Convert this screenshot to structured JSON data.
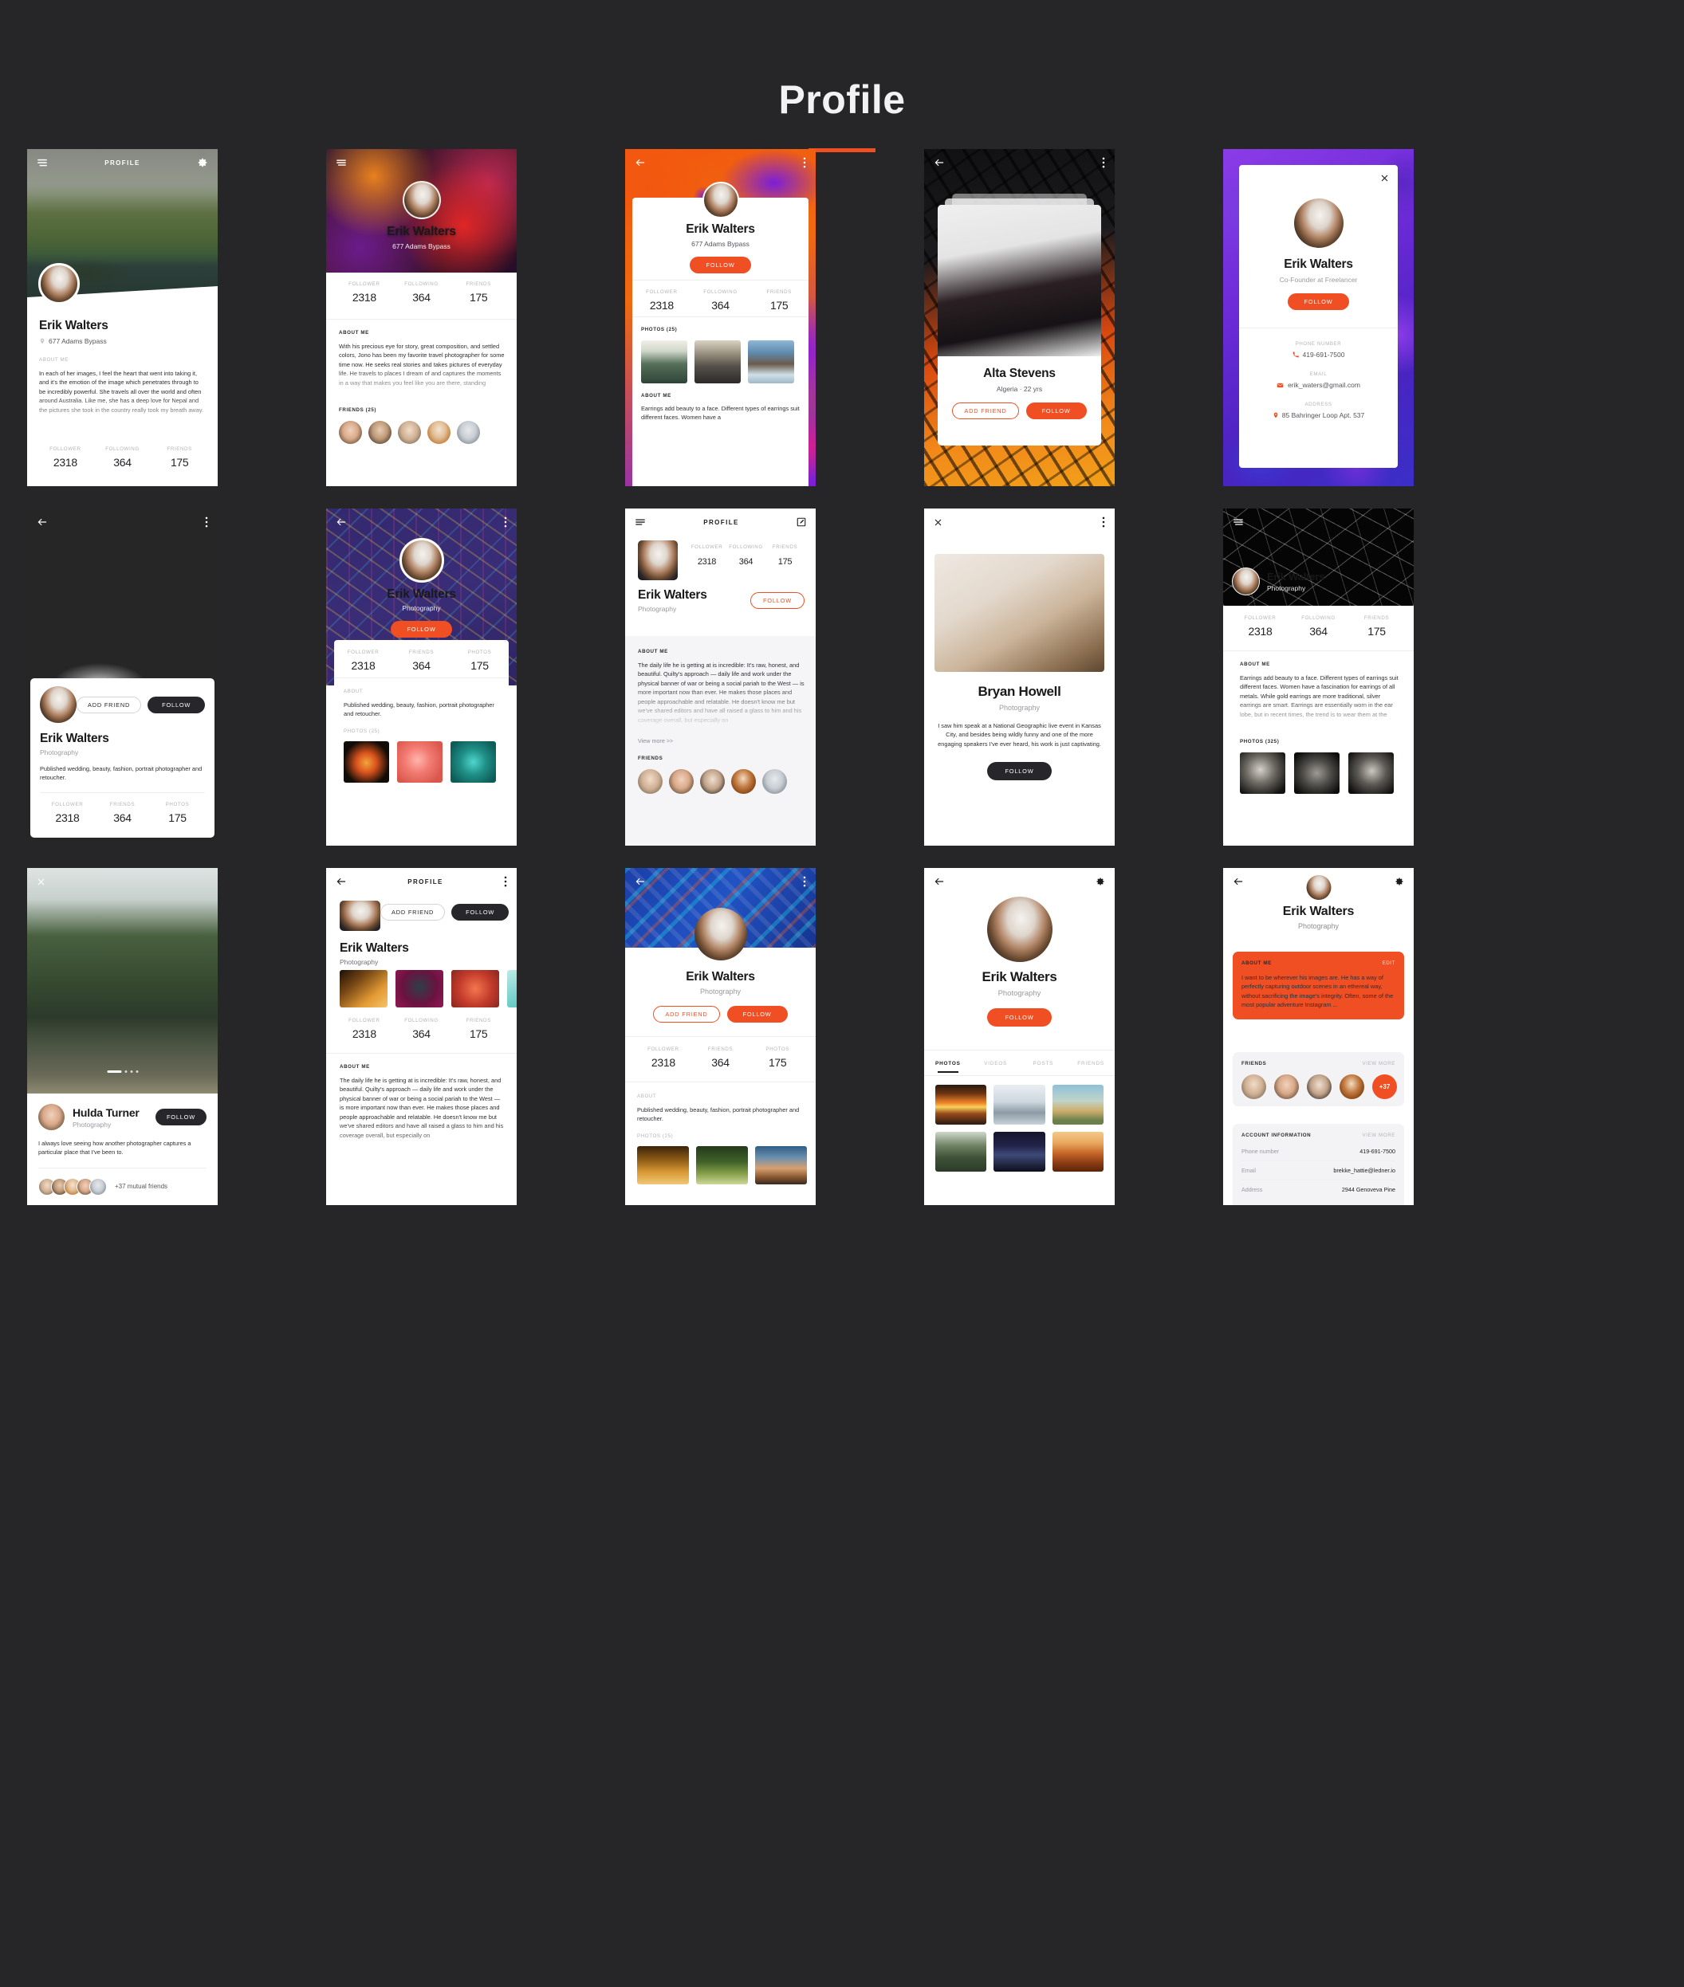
{
  "header": {
    "title": "Profile"
  },
  "common": {
    "person": "Erik Walters",
    "address_line": "677 Adams Bypass",
    "occupation": "Photography",
    "labels": {
      "follower": "FOLLOWER",
      "following": "FOLLOWING",
      "friends": "FRIENDS",
      "photos": "PHOTOS",
      "about_me": "ABOUT ME",
      "about": "ABOUT",
      "profile": "PROFILE"
    },
    "stats": {
      "follower": "2318",
      "following": "364",
      "friends": "175",
      "photos": "175"
    },
    "buttons": {
      "follow": "FOLLOW",
      "add_friend": "ADD FRIEND",
      "edit": "EDIT",
      "view_more": "VIEW MORE",
      "view_more_arrows": "View more >>"
    }
  },
  "bios": {
    "her_images": "In each of her images, I feel the heart that went into taking it, and it's the emotion of the image which penetrates through to be incredibly powerful. She travels all over the world and often around Australia. Like me, she has a deep love for Nepal and the pictures she took in the country really took my breath away.",
    "precious_eye": "With his precious eye for story, great composition, and settled colors, Jono has been my favorite travel photographer for some time now. He seeks real stories and takes pictures of everyday life. He travels to places I dream of and captures the moments in a way that makes you feel like you are there, standing",
    "earrings": "Earrings add beauty to a face. Different types of earrings suit different faces. Women have a fascination for earrings of all metals. While gold earrings are more traditional, silver earrings are smart. Earrings are essentially worn in the ear lobe, but in recent times, the trend is to wear them at the",
    "published": "Published wedding, beauty, fashion, portrait photographer and retoucher.",
    "daily_life": "The daily life he is getting at is incredible: It's raw, honest, and beautiful. Quilty's approach — daily life and work under the physical banner of war or being a social pariah to the West — is more important now than ever. He makes those places and people approachable and relatable. He doesn't know me but we've shared editors and have all raised a glass to him and his coverage overall, but especially on",
    "bryan_quote": "I saw him speak at a National Geographic live event in Kansas City, and besides being wildly funny and one of the more engaging speakers I've ever heard, his work is just captivating.",
    "hulda_quote": "I always love seeing how another photographer captures a particular place that I've been to.",
    "wherever": "I want to be wherever his images are. He has a way of perfectly capturing outdoor scenes in an ethereal way, without sacrificing the image's integrity. Often, some of the most popular adventure Instagram ..."
  },
  "screens": [
    {
      "id": "s1",
      "topbar_title": "PROFILE",
      "name": "Erik Walters",
      "location": "677 Adams Bypass",
      "section_label": "ABOUT ME",
      "stats": [
        {
          "label": "FOLLOWER",
          "value": "2318"
        },
        {
          "label": "FOLLOWING",
          "value": "364"
        },
        {
          "label": "FRIENDS",
          "value": "175"
        }
      ]
    },
    {
      "id": "s2",
      "name": "Erik Walters",
      "subtitle": "677 Adams Bypass",
      "section_label": "ABOUT ME",
      "friends_label": "FRIENDS (25)",
      "stats": [
        {
          "label": "FOLLOWER",
          "value": "2318"
        },
        {
          "label": "FOLLOWING",
          "value": "364"
        },
        {
          "label": "FRIENDS",
          "value": "175"
        }
      ]
    },
    {
      "id": "s3",
      "name": "Erik Walters",
      "subtitle": "677 Adams Bypass",
      "follow": "FOLLOW",
      "photos_label": "PHOTOS (25)",
      "section_label": "ABOUT ME",
      "about_excerpt": "Earrings add beauty to a face. Different types of earrings suit different faces. Women have a",
      "stats": [
        {
          "label": "FOLLOWER",
          "value": "2318"
        },
        {
          "label": "FOLLOWING",
          "value": "364"
        },
        {
          "label": "FRIENDS",
          "value": "175"
        }
      ]
    },
    {
      "id": "s4",
      "name": "Alta Stevens",
      "meta": "Algeria  ·  22 yrs",
      "add_friend": "ADD FRIEND",
      "follow": "FOLLOW"
    },
    {
      "id": "s5",
      "name": "Erik Walters",
      "subtitle": "Co-Founder at Freelancer",
      "follow": "FOLLOW",
      "fields": [
        {
          "label": "PHONE NUMBER",
          "value": "419-691-7500",
          "icon": "phone-icon"
        },
        {
          "label": "EMAIL",
          "value": "erik_waters@gmail.com",
          "icon": "mail-icon"
        },
        {
          "label": "ADDRESS",
          "value": "85 Bahringer Loop Apt. 537",
          "icon": "pin-icon"
        }
      ]
    },
    {
      "id": "s6",
      "name": "Erik Walters",
      "subtitle": "Photography",
      "add_friend": "ADD FRIEND",
      "follow": "FOLLOW",
      "bio": "Published wedding, beauty, fashion, portrait photographer and retoucher.",
      "stats": [
        {
          "label": "FOLLOWER",
          "value": "2318"
        },
        {
          "label": "FRIENDS",
          "value": "364"
        },
        {
          "label": "PHOTOS",
          "value": "175"
        }
      ]
    },
    {
      "id": "s7",
      "name": "Erik Walters",
      "subtitle": "Photography",
      "follow": "FOLLOW",
      "section_label": "ABOUT",
      "photos_label": "PHOTOS (25)",
      "bio": "Published wedding, beauty, fashion, portrait photographer and retoucher.",
      "stats": [
        {
          "label": "FOLLOWER",
          "value": "2318"
        },
        {
          "label": "FRIENDS",
          "value": "364"
        },
        {
          "label": "PHOTOS",
          "value": "175"
        }
      ]
    },
    {
      "id": "s8",
      "topbar_title": "PROFILE",
      "name": "Erik Walters",
      "subtitle": "Photography",
      "follow": "FOLLOW",
      "section_label": "ABOUT ME",
      "view_more": "View more >>",
      "friends_label": "FRIENDS",
      "stats": [
        {
          "label": "FOLLOWER",
          "value": "2318"
        },
        {
          "label": "FOLLOWING",
          "value": "364"
        },
        {
          "label": "FRIENDS",
          "value": "175"
        }
      ]
    },
    {
      "id": "s9",
      "name": "Bryan Howell",
      "subtitle": "Photography",
      "follow": "FOLLOW"
    },
    {
      "id": "s10",
      "name": "Erik Walters",
      "subtitle": "Photography",
      "section_label": "ABOUT ME",
      "photos_label": "PHOTOS (325)",
      "stats": [
        {
          "label": "FOLLOWER",
          "value": "2318"
        },
        {
          "label": "FOLLOWING",
          "value": "364"
        },
        {
          "label": "FRIENDS",
          "value": "175"
        }
      ]
    },
    {
      "id": "s11",
      "name": "Hulda Turner",
      "subtitle": "Photography",
      "follow": "FOLLOW",
      "mutual": "+37 mutual friends"
    },
    {
      "id": "s12",
      "topbar_title": "PROFILE",
      "name": "Erik Walters",
      "subtitle": "Photography",
      "add_friend": "ADD FRIEND",
      "follow": "FOLLOW",
      "section_label": "ABOUT ME",
      "stats": [
        {
          "label": "FOLLOWER",
          "value": "2318"
        },
        {
          "label": "FOLLOWING",
          "value": "364"
        },
        {
          "label": "FRIENDS",
          "value": "175"
        }
      ]
    },
    {
      "id": "s13",
      "name": "Erik Walters",
      "subtitle": "Photography",
      "add_friend": "ADD FRIEND",
      "follow": "FOLLOW",
      "section_label": "ABOUT",
      "photos_label": "PHOTOS (25)",
      "bio": "Published wedding, beauty, fashion, portrait photographer and retoucher.",
      "stats": [
        {
          "label": "FOLLOWER",
          "value": "2318"
        },
        {
          "label": "FRIENDS",
          "value": "364"
        },
        {
          "label": "PHOTOS",
          "value": "175"
        }
      ]
    },
    {
      "id": "s14",
      "name": "Erik Walters",
      "subtitle": "Photography",
      "follow": "FOLLOW",
      "tabs": [
        {
          "label": "PHOTOS",
          "active": true
        },
        {
          "label": "VIDEOS",
          "active": false
        },
        {
          "label": "POSTS",
          "active": false
        },
        {
          "label": "FRIENDS",
          "active": false
        }
      ]
    },
    {
      "id": "s15",
      "name": "Erik Walters",
      "subtitle": "Photography",
      "about_label": "ABOUT ME",
      "edit": "EDIT",
      "friends_label": "FRIENDS",
      "view_more": "VIEW MORE",
      "friends_overflow": "+37",
      "account_label": "ACCOUNT INFORMATION",
      "account_view_more": "VIEW MORE",
      "account_rows": [
        {
          "key": "Phone number",
          "value": "419-691-7500"
        },
        {
          "key": "Email",
          "value": "brekke_hattie@ledner.io"
        },
        {
          "key": "Address",
          "value": "2944 Genoveva Pine"
        }
      ]
    }
  ],
  "colors": {
    "accent": "#f04e23",
    "bg": "#262629",
    "dark": "#26262b"
  }
}
